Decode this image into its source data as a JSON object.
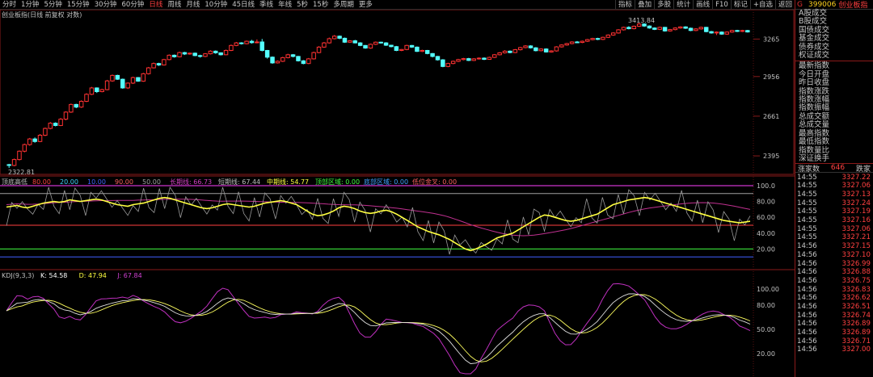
{
  "periods": [
    "分时",
    "1分钟",
    "5分钟",
    "15分钟",
    "30分钟",
    "60分钟",
    "日线",
    "周线",
    "月线",
    "10分钟",
    "45日线",
    "季线",
    "年线",
    "5秒",
    "15秒",
    "多周期",
    "更多"
  ],
  "active_period": "日线",
  "tools": [
    "指标",
    "叠加",
    "多股",
    "统计",
    "画线",
    "F10",
    "标记",
    "+自选",
    "返回"
  ],
  "main_header": "创业板指(日线 前复权 对数)",
  "main_axis": [
    "3265",
    "2956",
    "2661",
    "2395"
  ],
  "main_high_label": "3413.84",
  "main_low_label": "2322.81",
  "osc_header": {
    "name": "顶底高低",
    "items": [
      {
        "text": "80.00",
        "color": "#ff4040"
      },
      {
        "text": "20.00",
        "color": "#40d0ff"
      },
      {
        "text": "10.00",
        "color": "#4060ff"
      },
      {
        "text": "90.00",
        "color": "#ff6060"
      },
      {
        "text": "50.00",
        "color": "#a0a0a0"
      },
      {
        "text": "长期线: 66.73",
        "color": "#d040c0"
      },
      {
        "text": "短期线: 67.44",
        "color": "#c0c0c0"
      },
      {
        "text": "中期线: 54.77",
        "color": "#ffff40"
      },
      {
        "text": "顶部区域: 0.00",
        "color": "#40ff40"
      },
      {
        "text": "底部区域: 0.00",
        "color": "#40a0ff"
      },
      {
        "text": "低位金叉: 0.00",
        "color": "#ff6060"
      }
    ]
  },
  "osc_axis": [
    "100.0",
    "80.00",
    "60.00",
    "40.00",
    "20.00"
  ],
  "kdj_header": {
    "name": "KDJ(9,3,3)",
    "items": [
      {
        "text": "K: 54.58",
        "color": "#ffffff"
      },
      {
        "text": "D: 47.94",
        "color": "#ffff40"
      },
      {
        "text": "J: 67.84",
        "color": "#d040d0"
      }
    ]
  },
  "kdj_axis": [
    "100.00",
    "80.00",
    "50.00",
    "20.00"
  ],
  "right_panel": {
    "g": "G",
    "code": "399006",
    "name": "创业板指",
    "group1": [
      "A股成交",
      "B股成交",
      "国债成交",
      "基金成交",
      "债券成交",
      "权证成交"
    ],
    "group2": [
      "最新指数",
      "今日开盘",
      "昨日收盘",
      "指数涨跌",
      "指数涨幅",
      "指数振幅",
      "总成交额",
      "总成交量",
      "最高指数",
      "最低指数",
      "指数量比",
      "深证换手"
    ],
    "tick_header": {
      "left": "涨家数",
      "mid": "646",
      "right": "跌家"
    },
    "ticks": [
      {
        "t": "14:55",
        "p": "3327.22"
      },
      {
        "t": "14:55",
        "p": "3327.06"
      },
      {
        "t": "14:55",
        "p": "3327.13"
      },
      {
        "t": "14:55",
        "p": "3327.24"
      },
      {
        "t": "14:55",
        "p": "3327.19"
      },
      {
        "t": "14:55",
        "p": "3327.16"
      },
      {
        "t": "14:55",
        "p": "3327.06"
      },
      {
        "t": "14:55",
        "p": "3327.21"
      },
      {
        "t": "14:56",
        "p": "3327.15"
      },
      {
        "t": "14:56",
        "p": "3327.10"
      },
      {
        "t": "14:56",
        "p": "3326.99"
      },
      {
        "t": "14:56",
        "p": "3326.88"
      },
      {
        "t": "14:56",
        "p": "3326.75"
      },
      {
        "t": "14:56",
        "p": "3326.83"
      },
      {
        "t": "14:56",
        "p": "3326.62"
      },
      {
        "t": "14:56",
        "p": "3326.51"
      },
      {
        "t": "14:56",
        "p": "3326.74"
      },
      {
        "t": "14:56",
        "p": "3326.89"
      },
      {
        "t": "14:56",
        "p": "3326.89"
      },
      {
        "t": "14:56",
        "p": "3326.71"
      },
      {
        "t": "14:56",
        "p": "3327.00"
      }
    ]
  },
  "chart_data": {
    "type": "candlestick",
    "candles": [
      [
        2340,
        2335,
        2320,
        2345
      ],
      [
        2335,
        2372,
        2330,
        2378
      ],
      [
        2372,
        2425,
        2366,
        2430
      ],
      [
        2425,
        2468,
        2418,
        2474
      ],
      [
        2468,
        2505,
        2460,
        2512
      ],
      [
        2505,
        2488,
        2480,
        2515
      ],
      [
        2488,
        2530,
        2484,
        2538
      ],
      [
        2530,
        2576,
        2524,
        2582
      ],
      [
        2576,
        2612,
        2570,
        2620
      ],
      [
        2612,
        2596,
        2590,
        2618
      ],
      [
        2596,
        2640,
        2592,
        2648
      ],
      [
        2640,
        2690,
        2632,
        2696
      ],
      [
        2690,
        2745,
        2684,
        2752
      ],
      [
        2745,
        2726,
        2718,
        2750
      ],
      [
        2726,
        2768,
        2720,
        2775
      ],
      [
        2768,
        2820,
        2762,
        2828
      ],
      [
        2820,
        2868,
        2814,
        2876
      ],
      [
        2868,
        2840,
        2830,
        2872
      ],
      [
        2840,
        2855,
        2835,
        2862
      ],
      [
        2855,
        2922,
        2850,
        2930
      ],
      [
        2922,
        2965,
        2915,
        2972
      ],
      [
        2965,
        2935,
        2930,
        2970
      ],
      [
        2935,
        2868,
        2862,
        2940
      ],
      [
        2868,
        2905,
        2860,
        2910
      ],
      [
        2905,
        2948,
        2898,
        2955
      ],
      [
        2948,
        2920,
        2915,
        2952
      ],
      [
        2920,
        2978,
        2915,
        2985
      ],
      [
        2978,
        3025,
        2972,
        3032
      ],
      [
        3025,
        3060,
        3020,
        3068
      ],
      [
        3060,
        3048,
        3040,
        3066
      ],
      [
        3048,
        3092,
        3044,
        3098
      ],
      [
        3092,
        3128,
        3086,
        3135
      ],
      [
        3128,
        3115,
        3108,
        3134
      ],
      [
        3115,
        3150,
        3110,
        3158
      ],
      [
        3150,
        3138,
        3130,
        3156
      ],
      [
        3138,
        3145,
        3132,
        3150
      ],
      [
        3145,
        3125,
        3120,
        3150
      ],
      [
        3125,
        3118,
        3108,
        3132
      ],
      [
        3118,
        3140,
        3112,
        3146
      ],
      [
        3140,
        3162,
        3134,
        3170
      ],
      [
        3162,
        3148,
        3140,
        3168
      ],
      [
        3148,
        3132,
        3126,
        3152
      ],
      [
        3132,
        3168,
        3128,
        3175
      ],
      [
        3168,
        3210,
        3162,
        3218
      ],
      [
        3210,
        3232,
        3204,
        3240
      ],
      [
        3232,
        3225,
        3218,
        3238
      ],
      [
        3225,
        3246,
        3220,
        3252
      ],
      [
        3246,
        3234,
        3226,
        3258
      ],
      [
        3234,
        3240,
        3228,
        3262
      ],
      [
        3240,
        3168,
        3160,
        3266
      ],
      [
        3168,
        3112,
        3100,
        3172
      ],
      [
        3112,
        3065,
        3058,
        3118
      ],
      [
        3065,
        3078,
        3060,
        3085
      ],
      [
        3078,
        3108,
        3072,
        3115
      ],
      [
        3108,
        3132,
        3102,
        3140
      ],
      [
        3132,
        3118,
        3110,
        3138
      ],
      [
        3118,
        3082,
        3076,
        3122
      ],
      [
        3082,
        3060,
        3054,
        3088
      ],
      [
        3060,
        3098,
        3055,
        3105
      ],
      [
        3098,
        3150,
        3092,
        3158
      ],
      [
        3150,
        3196,
        3144,
        3204
      ],
      [
        3196,
        3232,
        3190,
        3240
      ],
      [
        3232,
        3268,
        3226,
        3278
      ],
      [
        3268,
        3290,
        3262,
        3300
      ],
      [
        3290,
        3272,
        3264,
        3296
      ],
      [
        3272,
        3238,
        3232,
        3278
      ],
      [
        3238,
        3250,
        3232,
        3256
      ],
      [
        3250,
        3232,
        3228,
        3258
      ],
      [
        3232,
        3210,
        3204,
        3238
      ],
      [
        3210,
        3188,
        3182,
        3214
      ],
      [
        3188,
        3220,
        3182,
        3226
      ],
      [
        3220,
        3238,
        3214,
        3244
      ],
      [
        3238,
        3232,
        3226,
        3242
      ],
      [
        3232,
        3212,
        3206,
        3238
      ],
      [
        3212,
        3200,
        3194,
        3216
      ],
      [
        3200,
        3168,
        3162,
        3206
      ],
      [
        3168,
        3176,
        3162,
        3180
      ],
      [
        3176,
        3210,
        3170,
        3216
      ],
      [
        3210,
        3196,
        3190,
        3214
      ],
      [
        3196,
        3160,
        3155,
        3202
      ],
      [
        3160,
        3168,
        3154,
        3174
      ],
      [
        3168,
        3142,
        3136,
        3172
      ],
      [
        3142,
        3118,
        3110,
        3146
      ],
      [
        3118,
        3090,
        3084,
        3122
      ],
      [
        3090,
        3036,
        3030,
        3096
      ],
      [
        3036,
        3060,
        3030,
        3066
      ],
      [
        3060,
        3078,
        3054,
        3084
      ],
      [
        3078,
        3092,
        3072,
        3098
      ],
      [
        3092,
        3100,
        3086,
        3106
      ],
      [
        3100,
        3085,
        3080,
        3106
      ],
      [
        3085,
        3098,
        3080,
        3104
      ],
      [
        3098,
        3104,
        3092,
        3110
      ],
      [
        3104,
        3094,
        3088,
        3110
      ],
      [
        3094,
        3110,
        3090,
        3116
      ],
      [
        3110,
        3132,
        3105,
        3138
      ],
      [
        3132,
        3148,
        3126,
        3154
      ],
      [
        3148,
        3162,
        3142,
        3170
      ],
      [
        3162,
        3150,
        3144,
        3168
      ],
      [
        3150,
        3174,
        3146,
        3180
      ],
      [
        3174,
        3192,
        3168,
        3198
      ],
      [
        3192,
        3206,
        3186,
        3212
      ],
      [
        3206,
        3190,
        3184,
        3212
      ],
      [
        3190,
        3166,
        3160,
        3196
      ],
      [
        3166,
        3180,
        3160,
        3186
      ],
      [
        3180,
        3155,
        3150,
        3186
      ],
      [
        3155,
        3164,
        3150,
        3170
      ],
      [
        3164,
        3198,
        3158,
        3204
      ],
      [
        3198,
        3214,
        3192,
        3220
      ],
      [
        3214,
        3226,
        3208,
        3232
      ],
      [
        3226,
        3240,
        3220,
        3246
      ],
      [
        3240,
        3236,
        3230,
        3248
      ],
      [
        3236,
        3246,
        3230,
        3252
      ],
      [
        3246,
        3260,
        3240,
        3266
      ],
      [
        3260,
        3270,
        3254,
        3276
      ],
      [
        3270,
        3262,
        3256,
        3276
      ],
      [
        3262,
        3280,
        3256,
        3286
      ],
      [
        3280,
        3300,
        3274,
        3306
      ],
      [
        3300,
        3318,
        3294,
        3324
      ],
      [
        3318,
        3346,
        3312,
        3352
      ],
      [
        3346,
        3368,
        3340,
        3374
      ],
      [
        3368,
        3356,
        3350,
        3378
      ],
      [
        3356,
        3378,
        3350,
        3384
      ],
      [
        3378,
        3398,
        3372,
        3414
      ],
      [
        3398,
        3380,
        3372,
        3404
      ],
      [
        3380,
        3362,
        3356,
        3386
      ],
      [
        3362,
        3350,
        3344,
        3368
      ],
      [
        3350,
        3368,
        3344,
        3374
      ],
      [
        3368,
        3336,
        3330,
        3372
      ],
      [
        3336,
        3348,
        3330,
        3354
      ],
      [
        3348,
        3362,
        3342,
        3368
      ],
      [
        3362,
        3372,
        3356,
        3378
      ],
      [
        3372,
        3360,
        3354,
        3378
      ],
      [
        3360,
        3340,
        3334,
        3366
      ],
      [
        3340,
        3354,
        3334,
        3360
      ],
      [
        3354,
        3368,
        3348,
        3374
      ],
      [
        3368,
        3330,
        3324,
        3372
      ],
      [
        3330,
        3318,
        3312,
        3336
      ],
      [
        3318,
        3326,
        3300,
        3332
      ],
      [
        3326,
        3308,
        3302,
        3332
      ],
      [
        3308,
        3326,
        3302,
        3332
      ],
      [
        3326,
        3340,
        3320,
        3346
      ],
      [
        3340,
        3332,
        3326,
        3346
      ],
      [
        3332,
        3340,
        3326,
        3346
      ],
      [
        3340,
        3327,
        3322,
        3345
      ]
    ],
    "osc_axis_values": [
      100,
      80,
      60,
      40,
      20
    ],
    "kdj_axis_values": [
      100,
      80,
      50,
      20
    ],
    "mid_line": [
      73,
      74,
      75,
      73,
      72,
      74,
      76,
      78,
      79,
      80,
      79,
      80,
      82,
      81,
      80,
      81,
      82,
      83,
      82,
      80,
      78,
      76,
      75,
      74,
      76,
      77,
      78,
      80,
      82,
      84,
      85,
      84,
      82,
      80,
      78,
      76,
      74,
      72,
      71,
      72,
      74,
      76,
      77,
      76,
      75,
      74,
      73,
      74,
      76,
      78,
      79,
      80,
      81,
      80,
      78,
      76,
      72,
      68,
      64,
      62,
      63,
      65,
      68,
      72,
      74,
      73,
      71,
      68,
      66,
      65,
      66,
      68,
      69,
      67,
      64,
      60,
      56,
      52,
      48,
      45,
      42,
      40,
      38,
      35,
      32,
      28,
      24,
      20,
      18,
      20,
      23,
      26,
      30,
      34,
      36,
      38,
      40,
      44,
      48,
      52,
      56,
      60,
      63,
      62,
      60,
      58,
      56,
      55,
      56,
      58,
      60,
      62,
      64,
      68,
      72,
      76,
      78,
      80,
      82,
      83,
      84,
      85,
      84,
      82,
      80,
      78,
      76,
      74,
      72,
      70,
      68,
      66,
      64,
      62,
      60,
      58,
      56,
      55,
      54,
      53,
      54,
      55
    ]
  }
}
